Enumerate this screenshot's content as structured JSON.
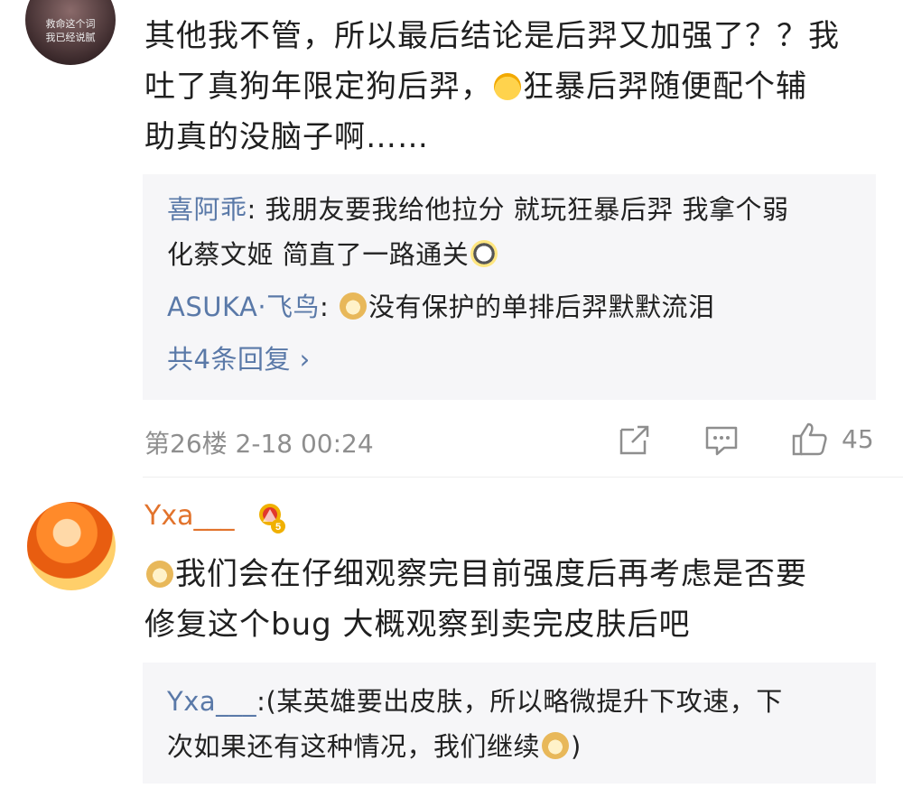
{
  "comment1": {
    "avatar_caption": [
      "救命这个词",
      "我已经说腻"
    ],
    "lines": [
      "其他我不管，所以最后结论是后羿又加强了？？我",
      "吐了真狗年限定狗后羿，",
      "狂暴后羿随便配个辅",
      "助真的没脑子啊……"
    ],
    "replies": [
      {
        "name": "喜阿乖",
        "sep": ": ",
        "text1": "我朋友要我给他拉分 就玩狂暴后羿  我拿个弱",
        "text2": "化蔡文姬  简直了一路通关"
      },
      {
        "name": "ASUKA·飞鸟",
        "sep": ": ",
        "text": "没有保护的单排后羿默默流泪"
      }
    ],
    "more_replies": "共4条回复",
    "more_chevron": "›",
    "floor": "第26楼",
    "time": "2-18 00:24",
    "like_count": "45"
  },
  "comment2": {
    "username": "Yxa___",
    "badge_level": "5",
    "line1": "我们会在仔细观察完目前强度后再考虑是否要",
    "line2": "修复这个bug  大概观察到卖完皮肤后吧",
    "reply_name": "Yxa___",
    "reply_sep": ":",
    "reply_text1": "(某英雄要出皮肤，所以略微提升下攻速，下",
    "reply_text2": "次如果还有这种情况，我们继续",
    "reply_text_end": ")"
  },
  "colors": {
    "link": "#5a79a8",
    "username_vip": "#e2732c",
    "meta": "#8e8e8e",
    "reply_bg": "#f6f6f8"
  },
  "icons": [
    "share-icon",
    "comment-icon",
    "like-icon",
    "crown-badge-icon"
  ]
}
